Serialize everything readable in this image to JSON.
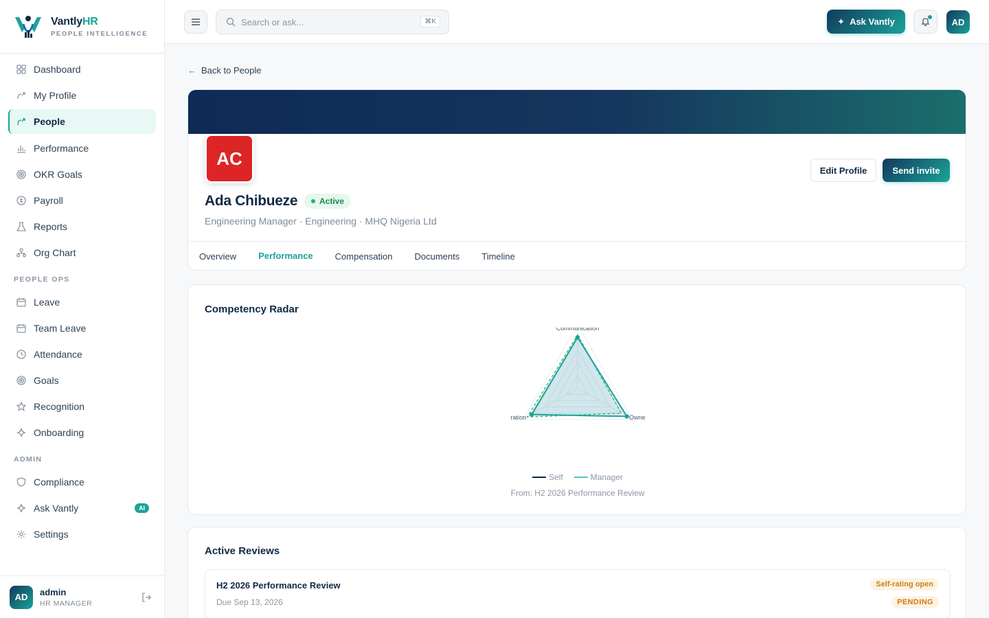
{
  "brand": {
    "name_main": "Vantly",
    "name_accent": "HR",
    "tagline": "PEOPLE INTELLIGENCE"
  },
  "sidebar": {
    "main_items": [
      {
        "label": "Dashboard",
        "icon": "grid-icon"
      },
      {
        "label": "My Profile",
        "icon": "user-icon"
      },
      {
        "label": "People",
        "icon": "users-icon",
        "active": true
      },
      {
        "label": "Performance",
        "icon": "bar-chart-icon"
      },
      {
        "label": "OKR Goals",
        "icon": "target-icon"
      },
      {
        "label": "Payroll",
        "icon": "currency-icon"
      },
      {
        "label": "Reports",
        "icon": "flask-icon"
      },
      {
        "label": "Org Chart",
        "icon": "org-chart-icon"
      }
    ],
    "section_people_ops": "PEOPLE OPS",
    "people_ops_items": [
      {
        "label": "Leave",
        "icon": "calendar-icon"
      },
      {
        "label": "Team Leave",
        "icon": "calendar-icon"
      },
      {
        "label": "Attendance",
        "icon": "clock-icon"
      },
      {
        "label": "Goals",
        "icon": "target-icon"
      },
      {
        "label": "Recognition",
        "icon": "star-icon"
      },
      {
        "label": "Onboarding",
        "icon": "sparkle-icon"
      }
    ],
    "section_admin": "ADMIN",
    "admin_items": [
      {
        "label": "Compliance",
        "icon": "shield-icon"
      },
      {
        "label": "Ask Vantly",
        "icon": "sparkle-icon",
        "badge": "AI"
      },
      {
        "label": "Settings",
        "icon": "gear-icon"
      }
    ],
    "user": {
      "initials": "AD",
      "name": "admin",
      "role": "HR MANAGER"
    }
  },
  "topbar": {
    "search_placeholder": "Search or ask...",
    "shortcut": "⌘K",
    "ask_label": "Ask Vantly",
    "avatar_initials": "AD"
  },
  "profile": {
    "back_label": "Back to People",
    "initials": "AC",
    "name": "Ada Chibueze",
    "status": "Active",
    "meta": "Engineering Manager · Engineering · MHQ Nigeria Ltd",
    "edit_label": "Edit Profile",
    "invite_label": "Send invite",
    "tabs": [
      "Overview",
      "Performance",
      "Compensation",
      "Documents",
      "Timeline"
    ],
    "active_tab": "Performance"
  },
  "colors": {
    "accent": "#1aa39a",
    "navy": "#0f2a44",
    "avatar_red": "#dd2526"
  },
  "radar": {
    "title": "Competency Radar",
    "legend_self": "Self",
    "legend_manager": "Manager",
    "source": "From: H2 2026 Performance Review",
    "chart_data": {
      "type": "radar",
      "axes": [
        "Communication",
        "Ownership",
        "Collaboration"
      ],
      "axis_labels_visible": [
        "Communication",
        "Owne",
        "ration"
      ],
      "series": [
        {
          "name": "Self",
          "values": [
            4,
            4.5,
            4.2
          ]
        },
        {
          "name": "Manager",
          "values": [
            4.2,
            4,
            4.6
          ]
        }
      ],
      "max": 5
    }
  },
  "reviews": {
    "title": "Active Reviews",
    "items": [
      {
        "title": "H2 2026 Performance Review",
        "due": "Due Sep 13, 2026",
        "stage": "Self-rating open",
        "status": "PENDING"
      }
    ]
  }
}
